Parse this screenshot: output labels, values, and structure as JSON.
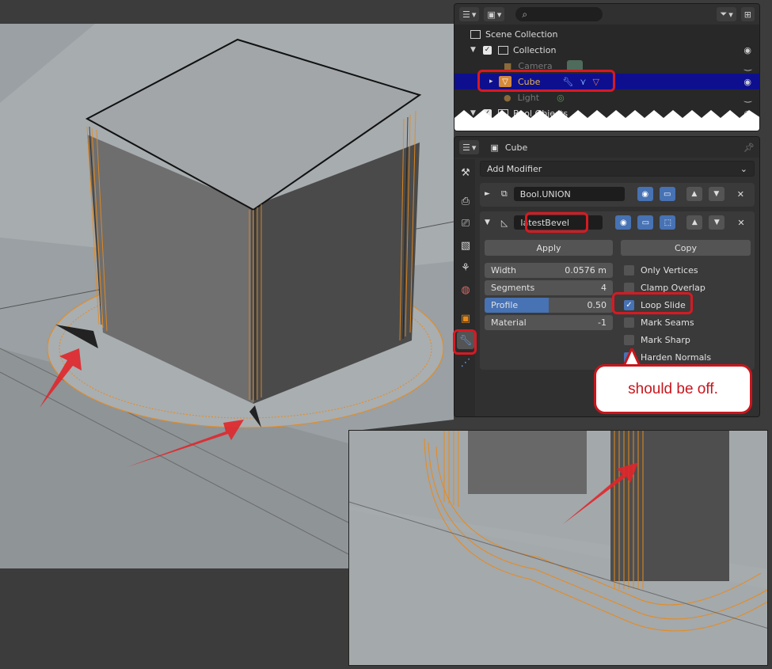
{
  "outliner": {
    "search_placeholder": "",
    "rows": [
      {
        "label": "Scene Collection"
      },
      {
        "label": "Collection"
      },
      {
        "label": "Camera"
      },
      {
        "label": "Cube"
      },
      {
        "label": "Light"
      },
      {
        "label": "Bool Objects"
      }
    ]
  },
  "properties": {
    "object_name": "Cube",
    "add_modifier": "Add Modifier",
    "modifiers": [
      {
        "name": "Bool.UNION",
        "expanded": false
      },
      {
        "name": "latestBevel",
        "expanded": true
      }
    ],
    "apply_label": "Apply",
    "copy_label": "Copy",
    "fields": [
      {
        "label": "Width",
        "value": "0.0576 m"
      },
      {
        "label": "Segments",
        "value": "4"
      },
      {
        "label": "Profile",
        "value": "0.50",
        "fill": 0.5
      },
      {
        "label": "Material",
        "value": "-1"
      }
    ],
    "checks": [
      {
        "label": "Only Vertices",
        "checked": false
      },
      {
        "label": "Clamp Overlap",
        "checked": false
      },
      {
        "label": "Loop Slide",
        "checked": true
      },
      {
        "label": "Mark Seams",
        "checked": false
      },
      {
        "label": "Mark Sharp",
        "checked": false
      },
      {
        "label": "Harden Normals",
        "checked": true
      }
    ]
  },
  "annotation": {
    "callout_text": "should be off."
  },
  "colors": {
    "accent_blue": "#4772b3",
    "selection_row": "#0e0f8e",
    "annotation_red": "#d61a22",
    "wire_orange": "#e88a1a"
  }
}
